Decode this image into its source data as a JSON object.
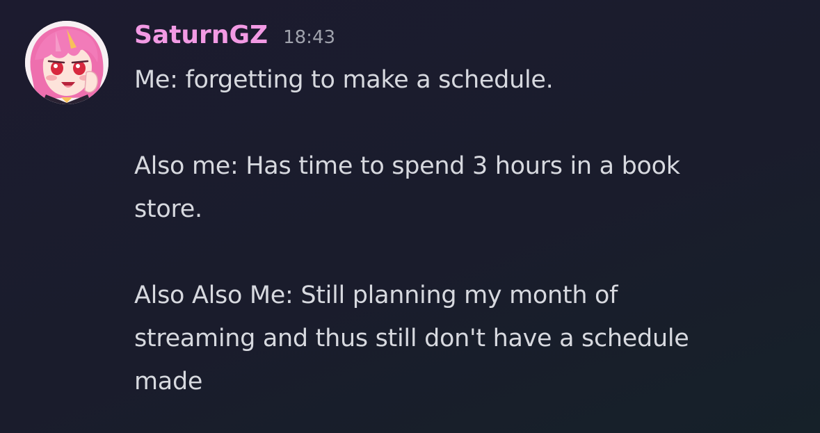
{
  "message": {
    "author": "SaturnGZ",
    "timestamp": "18:43",
    "avatar_icon": "anime-avatar-icon",
    "author_color": "#f29ae4",
    "paragraphs": [
      [
        "Me: forgetting to make a schedule."
      ],
      [
        "Also me: Has time to spend 3 hours in a book",
        "store."
      ],
      [
        "Also Also Me: Still planning my month of",
        "streaming and thus still don't have a schedule",
        "made"
      ]
    ]
  }
}
